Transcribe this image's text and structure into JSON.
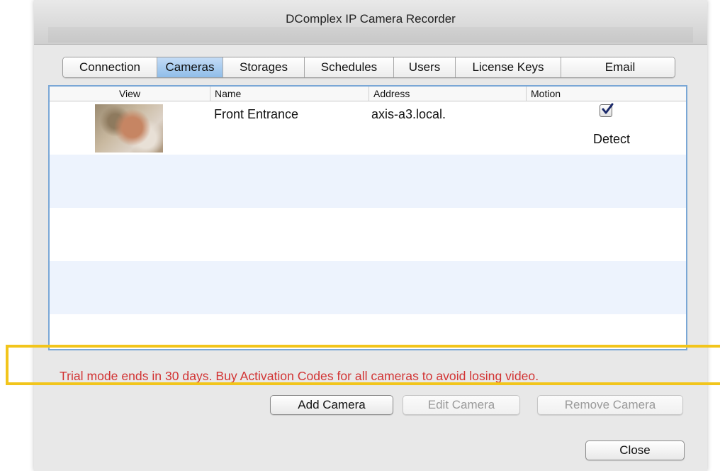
{
  "window": {
    "title": "DComplex IP Camera Recorder"
  },
  "tabs": [
    {
      "label": "Connection",
      "active": false
    },
    {
      "label": "Cameras",
      "active": true
    },
    {
      "label": "Storages",
      "active": false
    },
    {
      "label": "Schedules",
      "active": false
    },
    {
      "label": "Users",
      "active": false
    },
    {
      "label": "License Keys",
      "active": false
    },
    {
      "label": "Email",
      "active": false
    }
  ],
  "table": {
    "columns": [
      "View",
      "Name",
      "Address",
      "Motion"
    ],
    "rows": [
      {
        "name": "Front Entrance",
        "address": "axis-a3.local.",
        "motion_checked": true,
        "motion_label": "Detect"
      }
    ]
  },
  "notice": {
    "text": "Trial mode ends in 30 days. Buy Activation Codes for all cameras to avoid losing video.",
    "color": "#d23434",
    "highlight_color": "#f2c51b"
  },
  "buttons": {
    "add": "Add Camera",
    "edit": "Edit Camera",
    "remove": "Remove Camera",
    "close": "Close"
  },
  "colors": {
    "active_tab": "#8fbde9",
    "table_border": "#7aa7d6",
    "alt_row": "#edf3fd"
  }
}
